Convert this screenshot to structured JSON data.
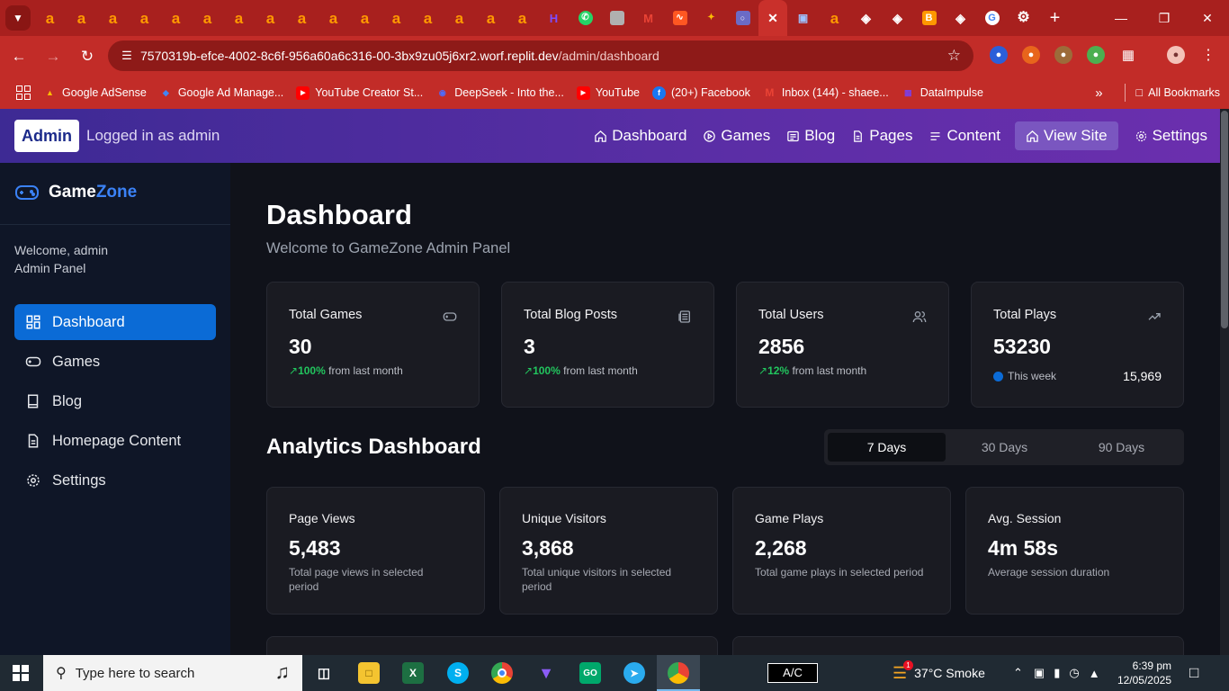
{
  "browser": {
    "url_host": "7570319b-efce-4002-8c6f-956a60a6c316-00-3bx9zu05j6xr2.worf.replit.dev",
    "url_path": "/admin/dashboard"
  },
  "bookmarks": [
    {
      "label": "Google AdSense",
      "color": "#fbbc04"
    },
    {
      "label": "Google Ad Manage...",
      "color": "#4285f4"
    },
    {
      "label": "YouTube Creator St...",
      "color": "#ff0000"
    },
    {
      "label": "DeepSeek - Into the...",
      "color": "#4d6bfe"
    },
    {
      "label": "YouTube",
      "color": "#ff0000"
    },
    {
      "label": "(20+) Facebook",
      "color": "#1877f2"
    },
    {
      "label": "Inbox (144) - shaee...",
      "color": "#ea4335"
    },
    {
      "label": "DataImpulse",
      "color": "#7b3fe4"
    }
  ],
  "all_bookmarks": "All Bookmarks",
  "topnav": {
    "badge": "Admin",
    "logged_in": "Logged in as admin",
    "links": {
      "dashboard": "Dashboard",
      "games": "Games",
      "blog": "Blog",
      "pages": "Pages",
      "content": "Content",
      "view_site": "View Site",
      "settings": "Settings"
    }
  },
  "sidebar": {
    "brand_a": "Game",
    "brand_b": "Zone",
    "welcome": "Welcome, admin",
    "panel": "Admin Panel",
    "items": [
      "Dashboard",
      "Games",
      "Blog",
      "Homepage Content",
      "Settings"
    ]
  },
  "main": {
    "title": "Dashboard",
    "subtitle": "Welcome to GameZone Admin Panel",
    "stats": [
      {
        "title": "Total Games",
        "value": "30",
        "trend": "100%",
        "trend_text": "from last month"
      },
      {
        "title": "Total Blog Posts",
        "value": "3",
        "trend": "100%",
        "trend_text": "from last month"
      },
      {
        "title": "Total Users",
        "value": "2856",
        "trend": "12%",
        "trend_text": "from last month"
      },
      {
        "title": "Total Plays",
        "value": "53230",
        "week_label": "This week",
        "week_value": "15,969"
      }
    ],
    "analytics_title": "Analytics Dashboard",
    "ranges": [
      "7 Days",
      "30 Days",
      "90 Days"
    ],
    "selected_range": "7 Days",
    "analytics": [
      {
        "title": "Page Views",
        "value": "5,483",
        "desc": "Total page views in selected period"
      },
      {
        "title": "Unique Visitors",
        "value": "3,868",
        "desc": "Total unique visitors in selected period"
      },
      {
        "title": "Game Plays",
        "value": "2,268",
        "desc": "Total game plays in selected period"
      },
      {
        "title": "Avg. Session",
        "value": "4m 58s",
        "desc": "Average session duration"
      }
    ]
  },
  "taskbar": {
    "search_placeholder": "Type here to search",
    "ac_label": "A/C",
    "weather": "37°C  Smoke",
    "weather_badge": "1",
    "time": "6:39 pm",
    "date": "12/05/2025"
  }
}
